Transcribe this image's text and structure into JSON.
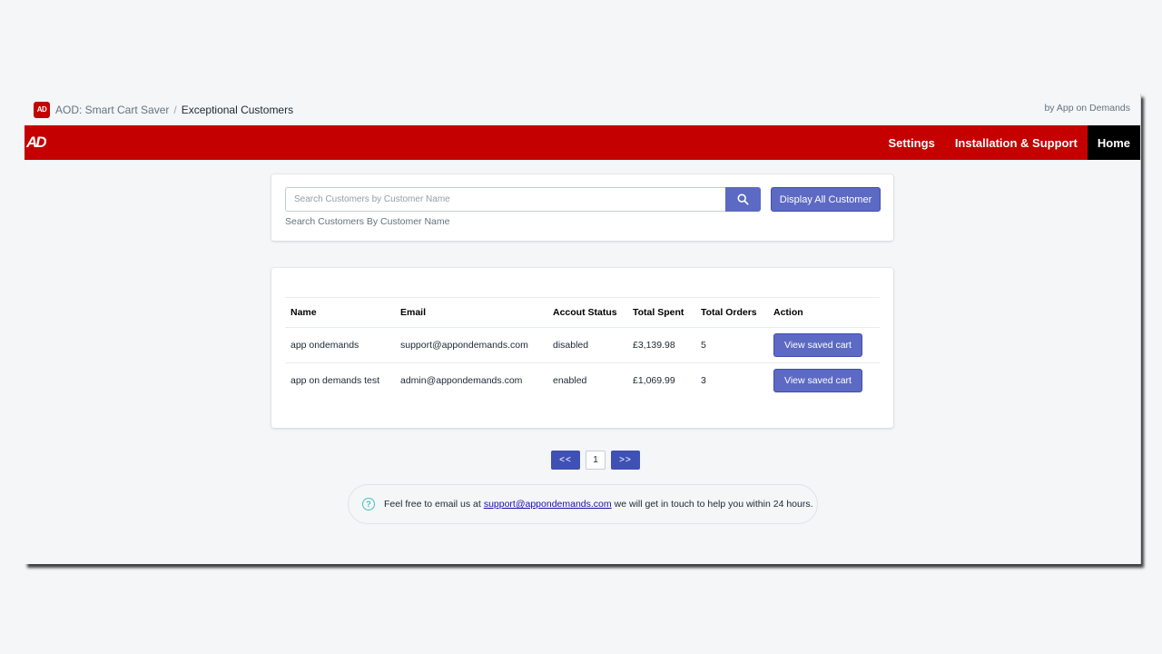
{
  "topbar": {
    "logo_text": "AD",
    "app_name": "AOD: Smart Cart Saver",
    "separator": "/",
    "page_title": "Exceptional Customers",
    "by_line": "by App on Demands"
  },
  "navbar": {
    "logo_text": "AD",
    "items": [
      {
        "label": "Settings"
      },
      {
        "label": "Installation & Support"
      },
      {
        "label": "Home"
      }
    ]
  },
  "search": {
    "placeholder": "Search Customers by Customer Name",
    "value": "",
    "help_text": "Search Customers By Customer Name",
    "display_all_label": "Display All Customer"
  },
  "table": {
    "headers": [
      "Name",
      "Email",
      "Accout Status",
      "Total Spent",
      "Total Orders",
      "Action"
    ],
    "rows": [
      {
        "name": "app ondemands",
        "email": "support@appondemands.com",
        "status": "disabled",
        "spent": "£3,139.98",
        "orders": "5",
        "action": "View saved cart"
      },
      {
        "name": "app on demands test",
        "email": "admin@appondemands.com",
        "status": "enabled",
        "spent": "£1,069.99",
        "orders": "3",
        "action": "View saved cart"
      }
    ]
  },
  "pagination": {
    "prev": "<<",
    "current": "1",
    "next": ">>"
  },
  "footer": {
    "text_before": "Feel free to email us at",
    "link": "support@appondemands.com",
    "text_after": "we will get in touch to help you within 24 hours."
  },
  "colors": {
    "brand_red": "#c40000",
    "primary_button": "#5c6ac4",
    "pagination_button": "#3f51b5"
  }
}
